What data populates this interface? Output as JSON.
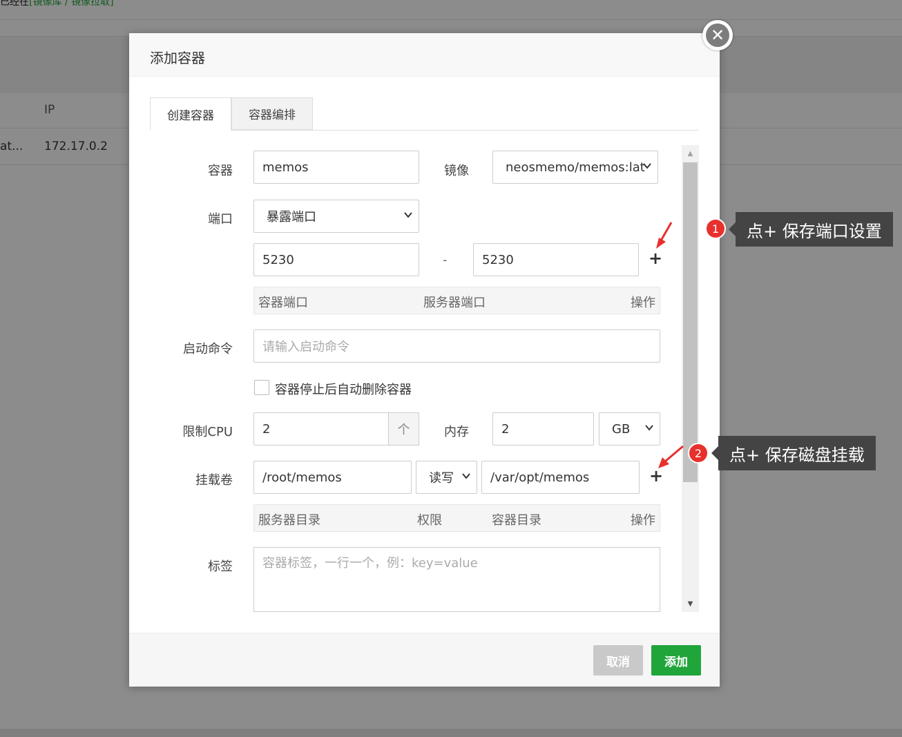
{
  "background": {
    "top_text_prefix": "已经在",
    "top_text_link": "[镜像库 / 镜像拉取]",
    "table_header_ip": "IP",
    "row_col1": "at...",
    "row_ip": "172.17.0.2"
  },
  "modal": {
    "title": "添加容器",
    "tabs": [
      "创建容器",
      "容器编排"
    ],
    "form": {
      "container_label": "容器",
      "container_value": "memos",
      "image_label": "镜像",
      "image_value": "neosmemo/memos:lat",
      "port_label": "端口",
      "port_mode": "暴露端口",
      "port_container": "5230",
      "port_separator": "-",
      "port_server": "5230",
      "port_table_headers": [
        "容器端口",
        "服务器端口",
        "操作"
      ],
      "command_label": "启动命令",
      "command_placeholder": "请输入启动命令",
      "auto_remove_label": "容器停止后自动删除容器",
      "cpu_label": "限制CPU",
      "cpu_value": "2",
      "cpu_step_icon": "个",
      "memory_label": "内存",
      "memory_value": "2",
      "memory_unit": "GB",
      "volume_label": "挂载卷",
      "volume_server": "/root/memos",
      "volume_mode": "读写",
      "volume_container": "/var/opt/memos",
      "volume_table_headers": [
        "服务器目录",
        "权限",
        "容器目录",
        "操作"
      ],
      "tag_label": "标签",
      "tag_placeholder": "容器标签，一行一个，例：key=value",
      "add_symbol": "+"
    },
    "buttons": {
      "cancel": "取消",
      "add": "添加"
    }
  },
  "annotations": [
    {
      "number": "1",
      "text": "点+ 保存端口设置"
    },
    {
      "number": "2",
      "text": "点+ 保存磁盘挂载"
    }
  ],
  "colors": {
    "primary": "#20a53a",
    "badge": "#e8302d",
    "tooltip": "#444444"
  }
}
